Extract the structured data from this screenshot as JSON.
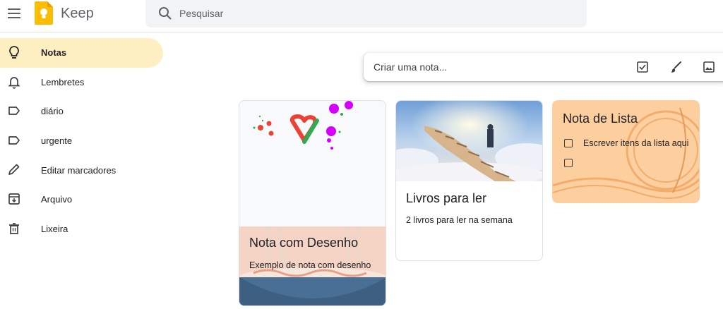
{
  "header": {
    "app_name": "Keep",
    "search_placeholder": "Pesquisar"
  },
  "sidebar": {
    "items": [
      {
        "label": "Notas",
        "icon": "lightbulb-icon",
        "active": true
      },
      {
        "label": "Lembretes",
        "icon": "bell-icon"
      },
      {
        "label": "diário",
        "icon": "label-icon"
      },
      {
        "label": "urgente",
        "icon": "label-icon"
      },
      {
        "label": "Editar marcadores",
        "icon": "pencil-icon"
      },
      {
        "label": "Arquivo",
        "icon": "archive-icon"
      },
      {
        "label": "Lixeira",
        "icon": "trash-icon"
      }
    ]
  },
  "take_note": {
    "placeholder": "Criar uma nota...",
    "actions": [
      "checkbox-icon",
      "brush-icon",
      "image-icon"
    ]
  },
  "notes": [
    {
      "title": "Nota com Desenho",
      "text": "Exemplo de nota com desenho"
    },
    {
      "title": "Livros para ler",
      "text": "2 livros para ler na semana"
    },
    {
      "title": "Nota de Lista",
      "items": [
        "Escrever itens da lista aqui",
        ""
      ]
    }
  ],
  "colors": {
    "accent": "#feefc3",
    "logo_yellow": "#fbbc04",
    "list_note_bg": "#fdcf9f"
  }
}
